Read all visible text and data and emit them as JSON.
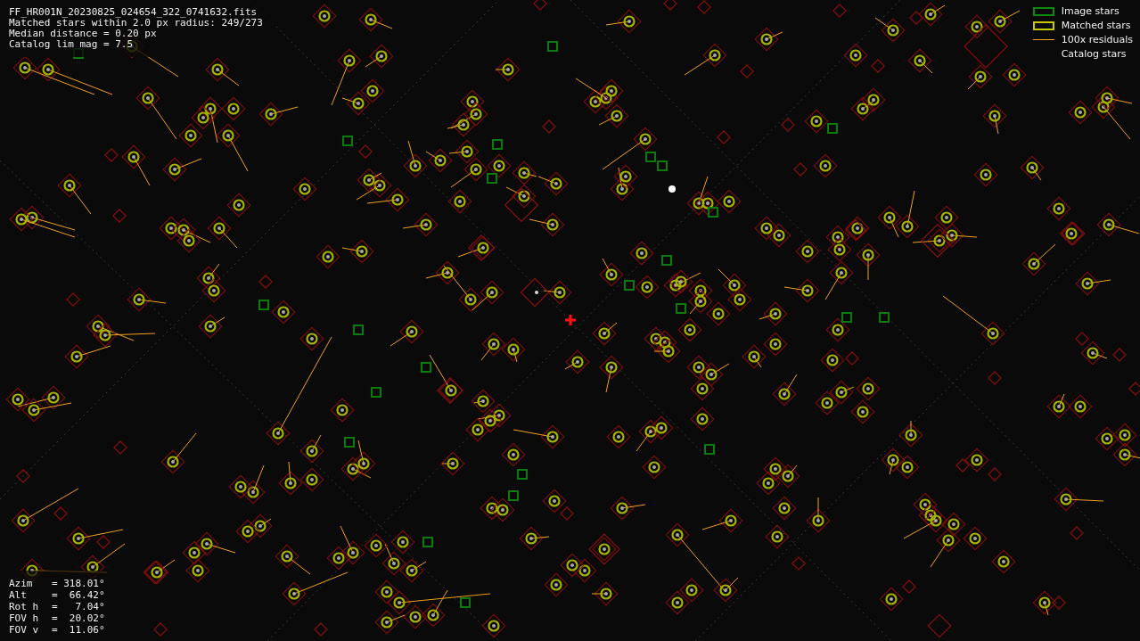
{
  "header_lines": [
    "FF_HR001N_20230825_024654_322_0741632.fits",
    "Matched stars within 2.0 px radius: 249/273",
    "Median distance = 0.20 px",
    "Catalog lim mag = 7.5"
  ],
  "legend": [
    {
      "kind": "image",
      "label": "Image stars"
    },
    {
      "kind": "matched",
      "label": "Matched stars"
    },
    {
      "kind": "residual",
      "label": "100x residuals"
    },
    {
      "kind": "catalog",
      "label": "Catalog stars"
    }
  ],
  "pointing": [
    {
      "label": "Azim",
      "value": "= 318.01°"
    },
    {
      "label": "Alt",
      "value": "=  66.42°"
    },
    {
      "label": "Rot h",
      "value": "=   7.04°"
    },
    {
      "label": "FOV h",
      "value": "=  20.02°"
    },
    {
      "label": "FOV v",
      "value": "=  11.06°"
    }
  ]
}
